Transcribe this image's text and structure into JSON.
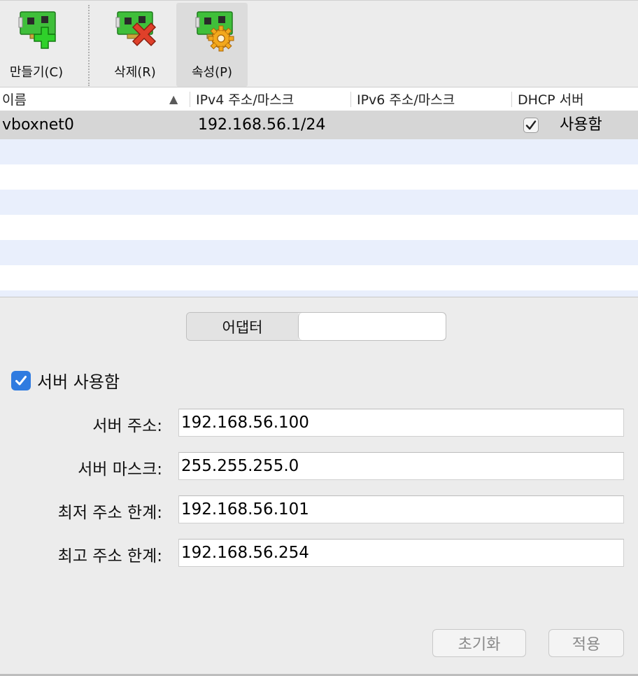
{
  "toolbar": {
    "create_label": "만들기(C)",
    "delete_label": "삭제(R)",
    "properties_label": "속성(P)"
  },
  "table": {
    "headers": {
      "name": "이름",
      "ipv4": "IPv4 주소/마스크",
      "ipv6": "IPv6 주소/마스크",
      "dhcp": "DHCP 서버"
    },
    "sort_indicator": "▲",
    "rows": [
      {
        "name": "vboxnet0",
        "ipv4": "192.168.56.1/24",
        "ipv6": "",
        "dhcp_enabled": true,
        "dhcp_label": "사용함"
      }
    ]
  },
  "tabs": {
    "adapter": "어댑터",
    "dhcp_server": ""
  },
  "dhcp": {
    "enable_label": "서버 사용함",
    "enabled": true,
    "server_address_label": "서버 주소:",
    "server_address": "192.168.56.100",
    "server_mask_label": "서버 마스크:",
    "server_mask": "255.255.255.0",
    "lower_bound_label": "최저 주소 한계:",
    "lower_bound": "192.168.56.101",
    "upper_bound_label": "최고 주소 한계:",
    "upper_bound": "192.168.56.254"
  },
  "buttons": {
    "reset": "초기화",
    "apply": "적용"
  },
  "colors": {
    "accent": "#2f7be0",
    "row_alt": "#e9effc",
    "row_selected": "#d6d6d6",
    "icon_green": "#3fbf3a",
    "icon_red": "#e0402a",
    "icon_gear": "#f3a81c"
  }
}
